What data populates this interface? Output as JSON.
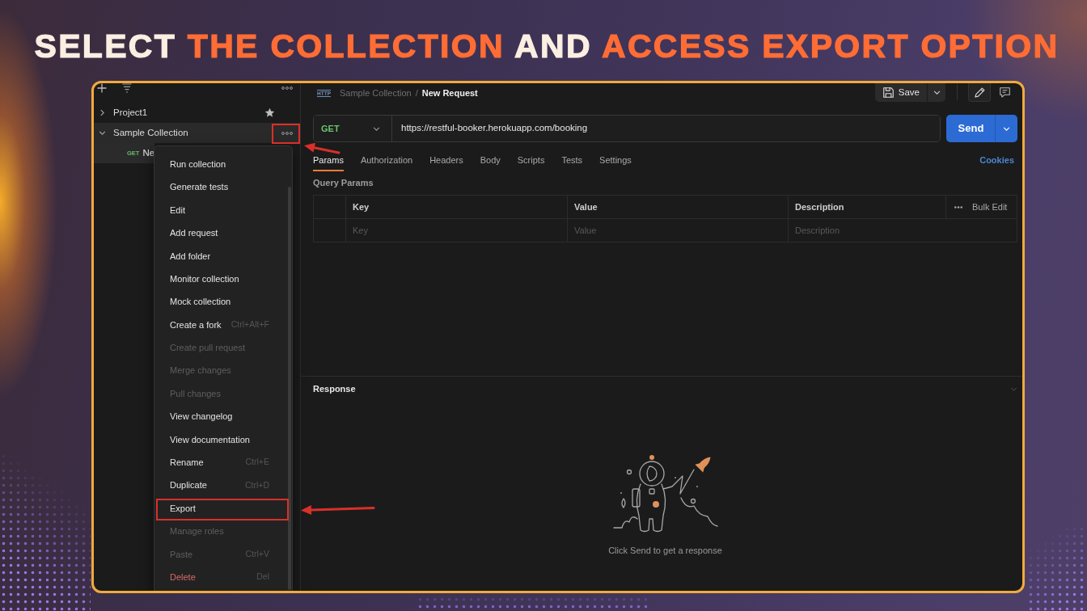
{
  "headline": [
    {
      "text": "SELECT",
      "accent": false
    },
    {
      "text": "THE COLLECTION",
      "accent": true
    },
    {
      "text": "AND",
      "accent": false
    },
    {
      "text": "ACCESS EXPORT OPTION",
      "accent": true
    }
  ],
  "sidebar": {
    "tree": [
      {
        "label": "Project1",
        "expanded": false,
        "selected": false,
        "trailing": {
          "kind": "star"
        },
        "marked": false
      },
      {
        "label": "Sample Collection",
        "expanded": true,
        "selected": true,
        "trailing": {
          "kind": "more"
        },
        "marked": true,
        "children": [
          {
            "method": "GET",
            "label": "Ne",
            "selected": true
          }
        ]
      }
    ]
  },
  "context_menu": {
    "items": [
      {
        "label": "Run collection",
        "disabled": false,
        "kind": "normal",
        "marked": false
      },
      {
        "label": "Generate tests",
        "disabled": false,
        "kind": "normal",
        "marked": false
      },
      {
        "label": "Edit",
        "disabled": false,
        "kind": "normal",
        "marked": false
      },
      {
        "label": "Add request",
        "disabled": false,
        "kind": "normal",
        "marked": false
      },
      {
        "label": "Add folder",
        "disabled": false,
        "kind": "normal",
        "marked": false
      },
      {
        "label": "Monitor collection",
        "disabled": false,
        "kind": "normal",
        "marked": false
      },
      {
        "label": "Mock collection",
        "disabled": false,
        "kind": "normal",
        "marked": false
      },
      {
        "label": "Create a fork",
        "shortcut": "Ctrl+Alt+F",
        "disabled": false,
        "kind": "normal",
        "marked": false
      },
      {
        "label": "Create pull request",
        "disabled": true,
        "kind": "normal",
        "marked": false
      },
      {
        "label": "Merge changes",
        "disabled": true,
        "kind": "normal",
        "marked": false
      },
      {
        "label": "Pull changes",
        "disabled": true,
        "kind": "normal",
        "marked": false
      },
      {
        "label": "View changelog",
        "disabled": false,
        "kind": "normal",
        "marked": false
      },
      {
        "label": "View documentation",
        "disabled": false,
        "kind": "normal",
        "marked": false
      },
      {
        "label": "Rename",
        "shortcut": "Ctrl+E",
        "disabled": false,
        "kind": "normal",
        "marked": false
      },
      {
        "label": "Duplicate",
        "shortcut": "Ctrl+D",
        "disabled": false,
        "kind": "normal",
        "marked": false
      },
      {
        "label": "Export",
        "disabled": false,
        "kind": "normal",
        "marked": true
      },
      {
        "label": "Manage roles",
        "disabled": true,
        "kind": "normal",
        "marked": false
      },
      {
        "label": "Paste",
        "shortcut": "Ctrl+V",
        "disabled": true,
        "kind": "normal",
        "marked": false
      },
      {
        "label": "Delete",
        "shortcut": "Del",
        "disabled": false,
        "kind": "danger",
        "marked": false
      }
    ]
  },
  "request": {
    "type_label": "HTTP",
    "breadcrumb": [
      {
        "label": "Sample Collection",
        "current": false
      },
      {
        "label": "New Request",
        "current": true
      }
    ],
    "breadcrumb_separator": "/",
    "save_label": "Save",
    "method": "GET",
    "url": "https://restful-booker.herokuapp.com/booking",
    "send_label": "Send",
    "tabs": [
      {
        "label": "Params",
        "selected": true
      },
      {
        "label": "Authorization",
        "selected": false
      },
      {
        "label": "Headers",
        "selected": false
      },
      {
        "label": "Body",
        "selected": false
      },
      {
        "label": "Scripts",
        "selected": false
      },
      {
        "label": "Tests",
        "selected": false
      },
      {
        "label": "Settings",
        "selected": false
      }
    ],
    "cookies_link": "Cookies",
    "params_title": "Query Params",
    "params_table": {
      "columns": [
        "Key",
        "Value",
        "Description"
      ],
      "bulk_edit_label": "Bulk Edit",
      "placeholders": [
        "Key",
        "Value",
        "Description"
      ]
    }
  },
  "response": {
    "title": "Response",
    "empty_message": "Click Send to get a response"
  }
}
